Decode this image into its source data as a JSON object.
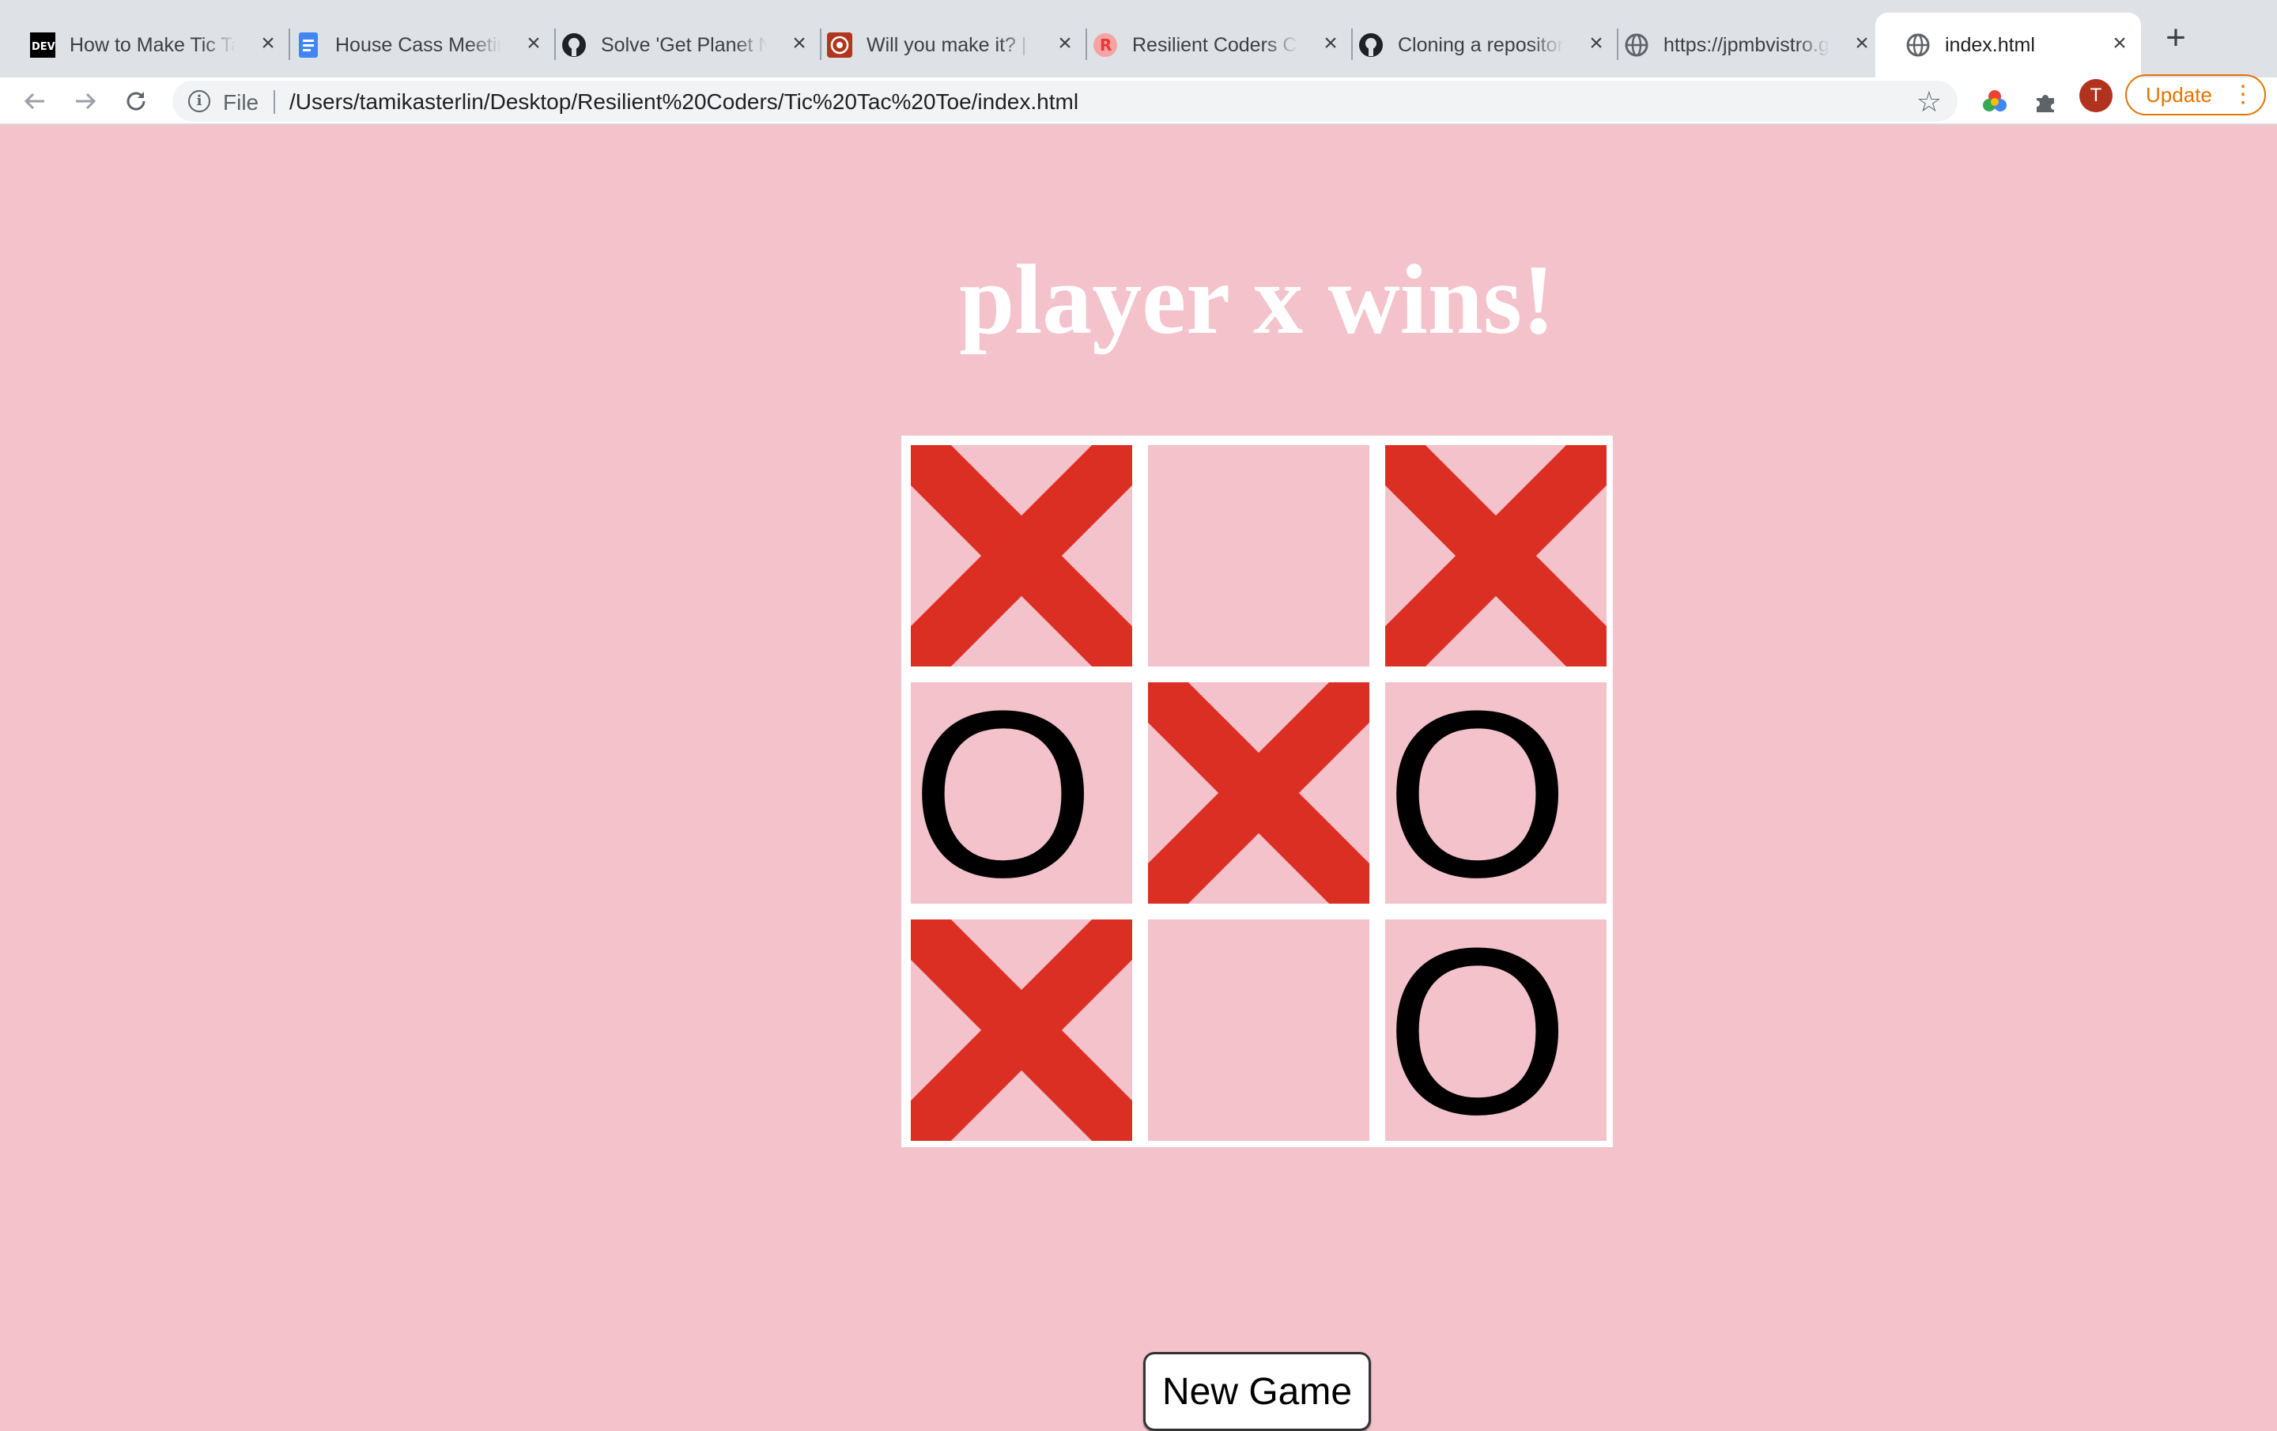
{
  "browser": {
    "tabs": [
      {
        "title": "How to Make Tic Tac Toe",
        "favicon": "dev-icon"
      },
      {
        "title": "House Cass Meeting",
        "favicon": "docs-icon"
      },
      {
        "title": "Solve 'Get Planet Name'",
        "favicon": "github-icon"
      },
      {
        "title": "Will you make it? | Codewars",
        "favicon": "codewars-icon"
      },
      {
        "title": "Resilient Coders Curriculum",
        "favicon": "resilient-icon"
      },
      {
        "title": "Cloning a repository",
        "favicon": "github-icon"
      },
      {
        "title": "https://jpmbvistro.github.io",
        "favicon": "globe-icon"
      },
      {
        "title": "index.html",
        "favicon": "globe-icon",
        "active": true
      }
    ],
    "omnibox": {
      "scheme": "File",
      "url": "/Users/tamikasterlin/Desktop/Resilient%20Coders/Tic%20Tac%20Toe/index.html"
    },
    "profile_initial": "T",
    "update_label": "Update"
  },
  "game": {
    "status": "player x wins!",
    "board": [
      "X",
      "",
      "X",
      "O",
      "X",
      "O",
      "X",
      "",
      "O"
    ],
    "x_color": "#dc2f24",
    "o_color": "#000000",
    "new_game_label": "New Game"
  },
  "colors": {
    "page_bg": "#f4c2cb",
    "grid_lines": "#ffffff",
    "update_accent": "#e37400"
  }
}
